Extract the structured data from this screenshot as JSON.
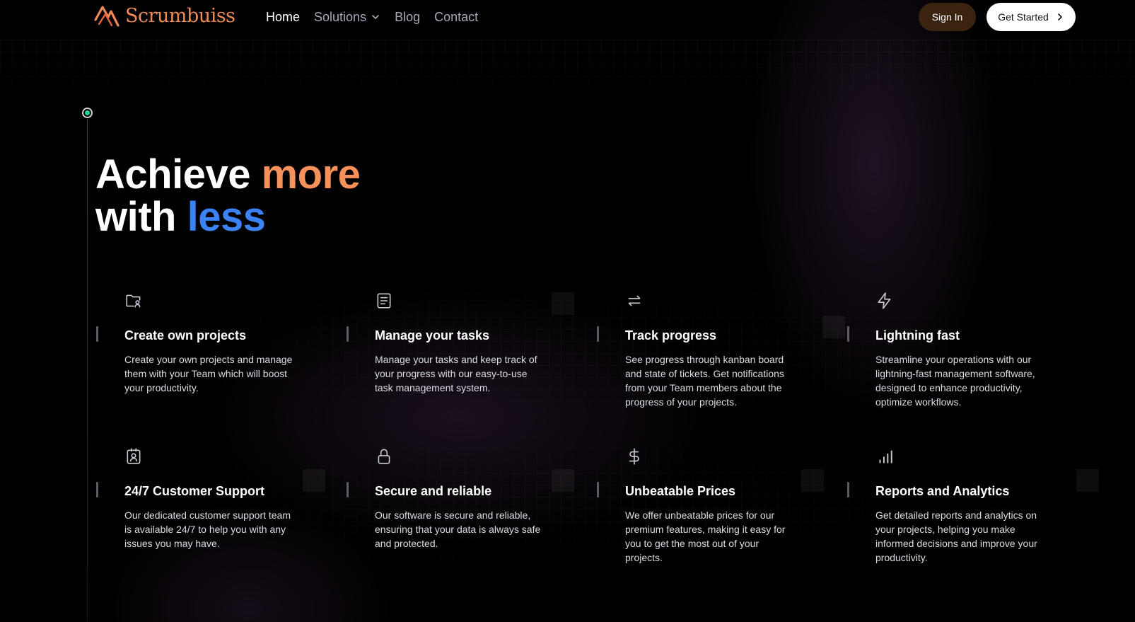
{
  "nav": {
    "brand": "Scrumbuiss",
    "links": [
      {
        "label": "Home",
        "active": true
      },
      {
        "label": "Solutions"
      },
      {
        "label": "Blog"
      },
      {
        "label": "Contact"
      }
    ],
    "signin_label": "Sign In",
    "getstarted_label": "Get Started"
  },
  "hero": {
    "line1_a": "Achieve ",
    "line1_b": "more",
    "line2_a": "with ",
    "line2_b": "less"
  },
  "features": [
    {
      "icon": "folder-user-icon",
      "title": "Create own projects",
      "description": "Create your own projects and manage them with your Team which will boost your productivity."
    },
    {
      "icon": "note-icon",
      "title": "Manage your tasks",
      "description": "Manage your tasks and keep track of your progress with our easy-to-use task management system."
    },
    {
      "icon": "arrows-left-right-icon",
      "title": "Track progress",
      "description": "See progress through kanban board and state of tickets. Get notifications from your Team members about the progress of your projects."
    },
    {
      "icon": "lightning-icon",
      "title": "Lightning fast",
      "description": "Streamline your operations with our lightning-fast management software, designed to enhance productivity, optimize workflows."
    },
    {
      "icon": "user-badge-icon",
      "title": "24/7 Customer Support",
      "description": "Our dedicated customer support team is available 24/7 to help you with any issues you may have."
    },
    {
      "icon": "lock-icon",
      "title": "Secure and reliable",
      "description": "Our software is secure and reliable, ensuring that your data is always safe and protected."
    },
    {
      "icon": "dollar-icon",
      "title": "Unbeatable Prices",
      "description": "We offer unbeatable prices for our premium features, making it easy for you to get the most out of your projects."
    },
    {
      "icon": "bar-chart-icon",
      "title": "Reports and Analytics",
      "description": "Get detailed reports and analytics on your projects, helping you make informed decisions and improve your productivity."
    }
  ],
  "colors": {
    "background": "#000000",
    "brand_orange": "#f08a55",
    "accent_orange": "#f6915a",
    "accent_blue": "#3b82f6",
    "nav_muted": "#a6a8b8",
    "signin_bg": "#3a2410",
    "timeline_dot": "#1fd39a"
  }
}
